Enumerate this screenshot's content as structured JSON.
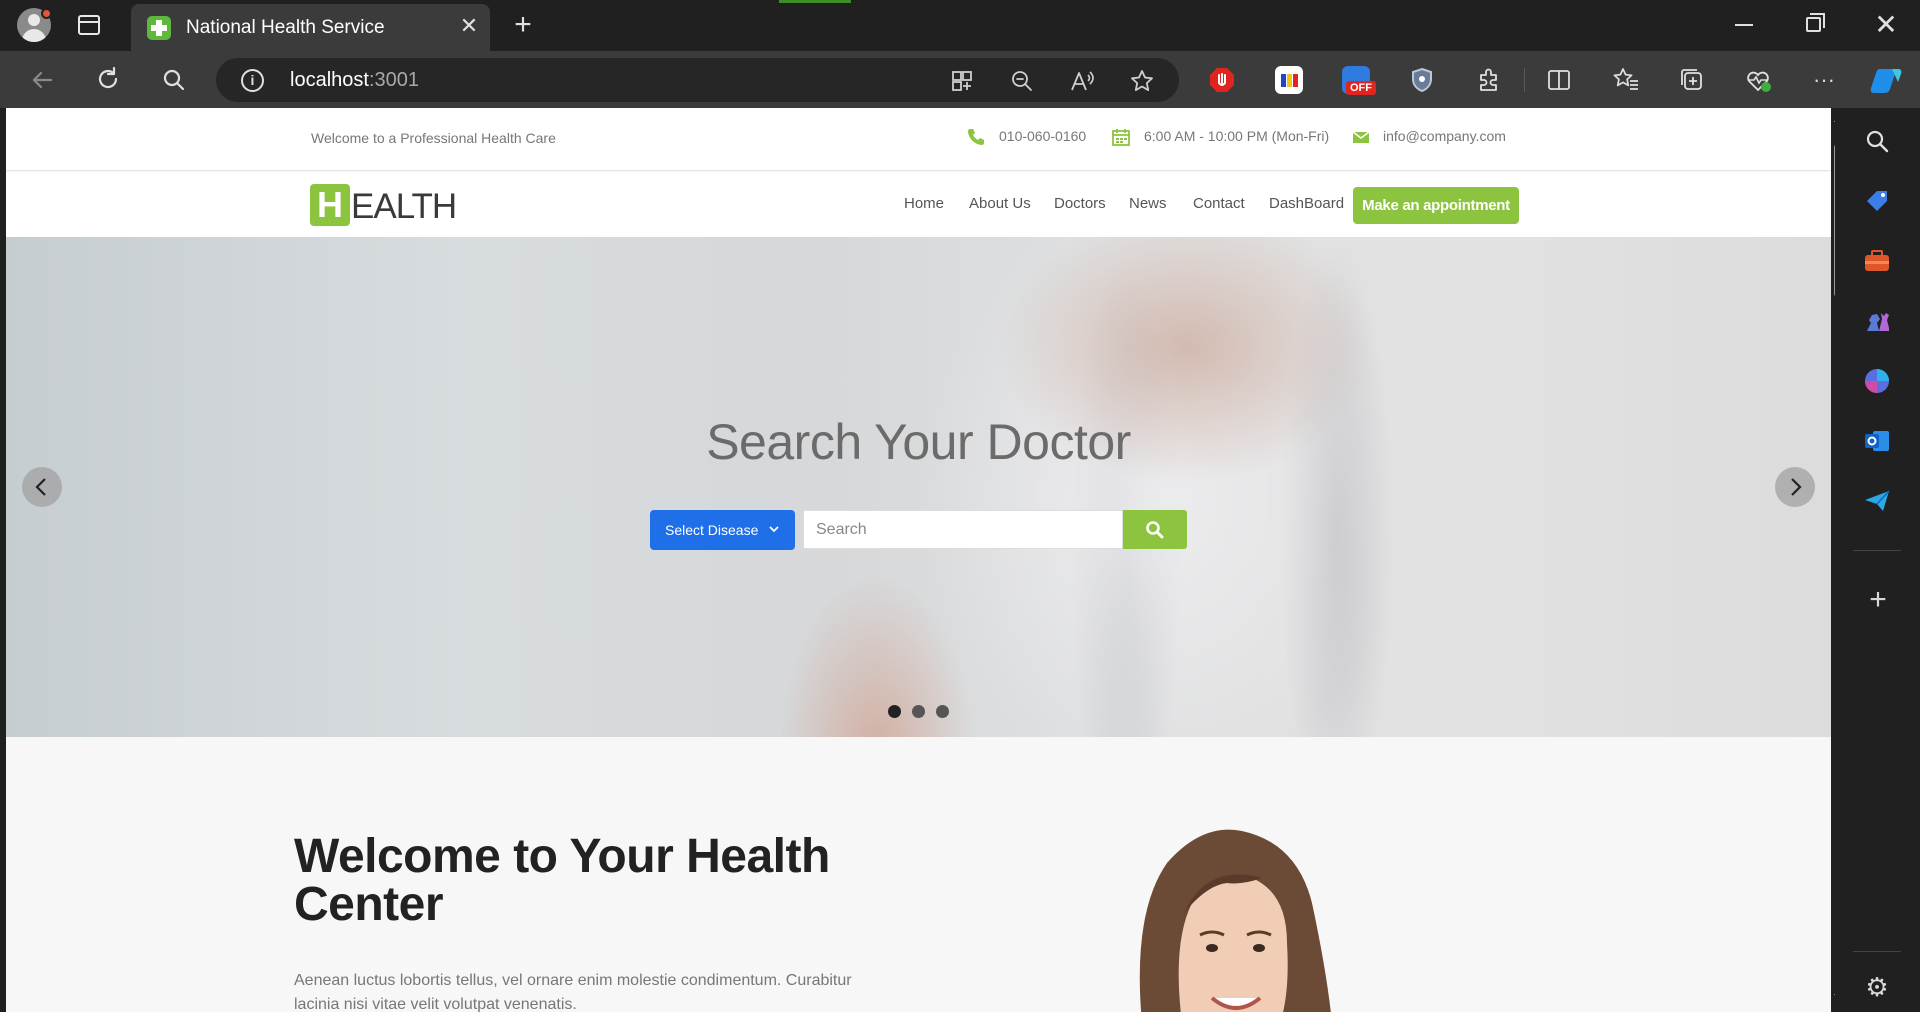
{
  "browser": {
    "tab_title": "National Health Service",
    "address_host": "localhost",
    "address_port": ":3001",
    "icons": [
      "profile-avatar-icon",
      "tab-actions-icon",
      "close-icon",
      "new-tab-icon",
      "minimize-icon",
      "restore-icon",
      "window-close-icon",
      "back-icon",
      "refresh-icon",
      "search-icon",
      "info-icon",
      "app-available-icon",
      "zoom-out-icon",
      "read-aloud-icon",
      "favorite-star-icon",
      "extensions-icon",
      "split-screen-icon",
      "favorites-icon",
      "collections-icon",
      "browser-essentials-icon",
      "more-icon",
      "copilot-icon"
    ],
    "extension_badge": "OFF"
  },
  "page": {
    "topbar": {
      "welcome": "Welcome to a Professional Health Care",
      "phone": "010-060-0160",
      "hours": "6:00 AM - 10:00 PM (Mon-Fri)",
      "email": "info@company.com"
    },
    "logo": {
      "initial": "H",
      "rest": "EALTH"
    },
    "nav": {
      "links": [
        "Home",
        "About Us",
        "Doctors",
        "News",
        "Contact",
        "DashBoard"
      ],
      "cta": "Make an appointment"
    },
    "hero": {
      "title": "Search Your Doctor",
      "select_label": "Select Disease",
      "search_placeholder": "Search",
      "slides": 3,
      "active_slide": 1
    },
    "welcome": {
      "title": "Welcome to Your Health Center",
      "text": "Aenean luctus lobortis tellus, vel ornare enim molestie condimentum. Curabitur lacinia nisi vitae velit volutpat venenatis."
    }
  },
  "colors": {
    "accent_green": "#8cc43f",
    "primary_blue": "#1f6fe8",
    "chrome_dark": "#202020",
    "chrome_mid": "#3b3b3b"
  }
}
